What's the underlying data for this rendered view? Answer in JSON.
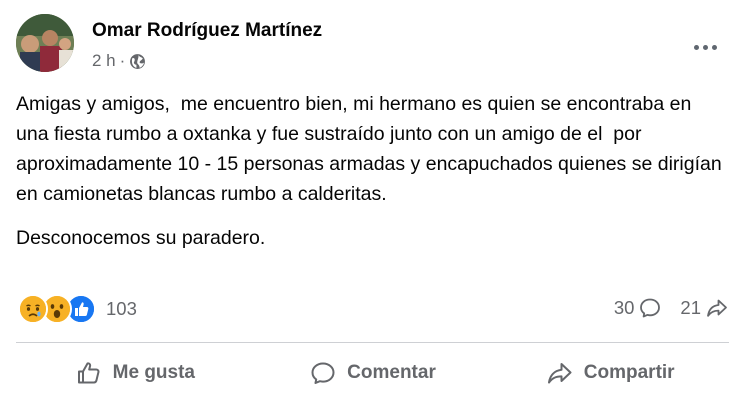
{
  "post": {
    "author": "Omar Rodríguez Martínez",
    "time": "2 h",
    "separator": "·",
    "privacy_icon": "globe-icon",
    "paragraphs": [
      "Amigas y amigos,  me encuentro bien, mi hermano es quien se encontraba en una fiesta rumbo a oxtanka y fue sustraído junto con un amigo de el  por aproximadamente 10 - 15 personas armadas y encapuchados quienes se dirigían en camionetas blancas rumbo a calderitas.",
      "Desconocemos su paradero."
    ]
  },
  "stats": {
    "reactions": [
      "sad-reaction-icon",
      "wow-reaction-icon",
      "like-reaction-icon"
    ],
    "reaction_count": "103",
    "comments": "30",
    "shares": "21"
  },
  "actions": {
    "like": "Me gusta",
    "comment": "Comentar",
    "share": "Compartir"
  },
  "colors": {
    "like_blue": "#1877f2",
    "reaction_yellow": "#f7b125",
    "secondary_text": "#65676b"
  }
}
